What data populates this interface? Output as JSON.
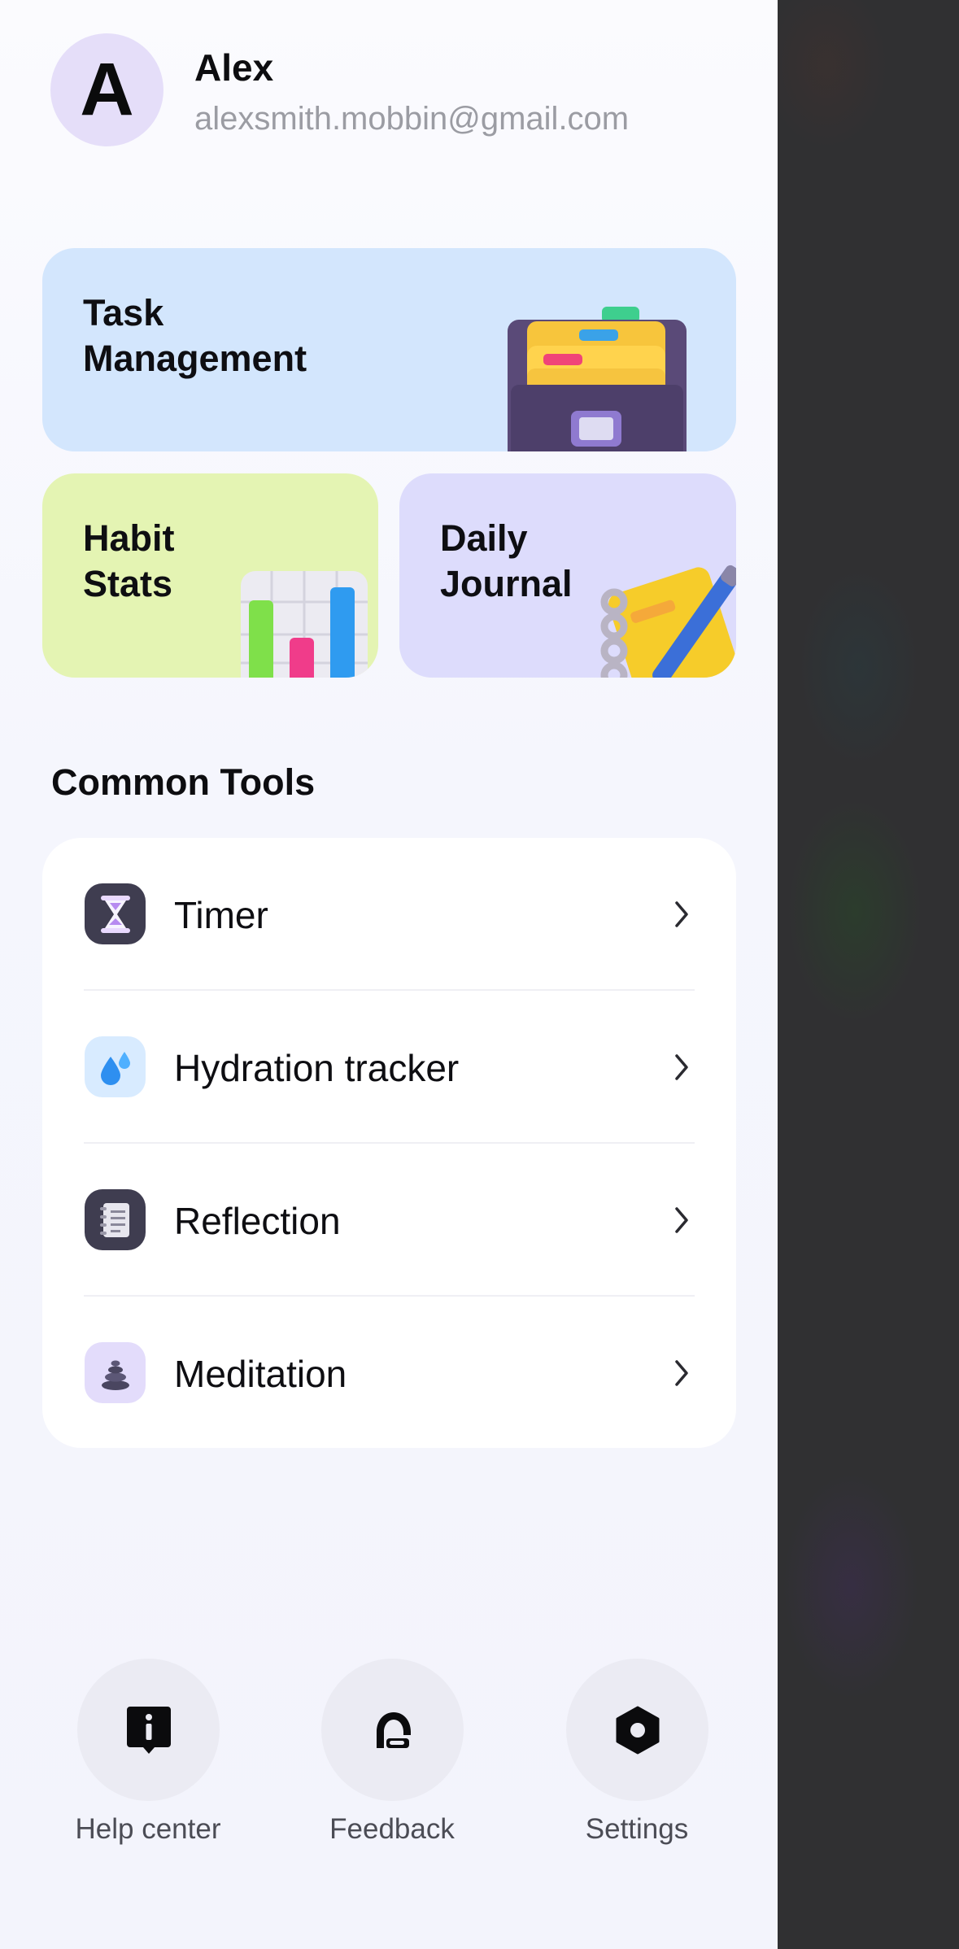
{
  "profile": {
    "initial": "A",
    "name": "Alex",
    "email": "alexsmith.mobbin@gmail.com"
  },
  "cards": {
    "task": {
      "label": "Task\nManagement",
      "color": "#d3e6fd"
    },
    "habit": {
      "label": "Habit\nStats",
      "color": "#e4f4b3"
    },
    "journal": {
      "label": "Daily\nJournal",
      "color": "#dddcfc"
    }
  },
  "common_tools": {
    "title": "Common Tools",
    "items": [
      {
        "label": "Timer",
        "icon": "hourglass-icon"
      },
      {
        "label": "Hydration tracker",
        "icon": "water-drop-icon"
      },
      {
        "label": "Reflection",
        "icon": "notebook-icon"
      },
      {
        "label": "Meditation",
        "icon": "stacked-stones-icon"
      }
    ]
  },
  "actions": [
    {
      "label": "Help center",
      "icon": "info-icon"
    },
    {
      "label": "Feedback",
      "icon": "headset-icon"
    },
    {
      "label": "Settings",
      "icon": "settings-hexagon-icon"
    }
  ]
}
